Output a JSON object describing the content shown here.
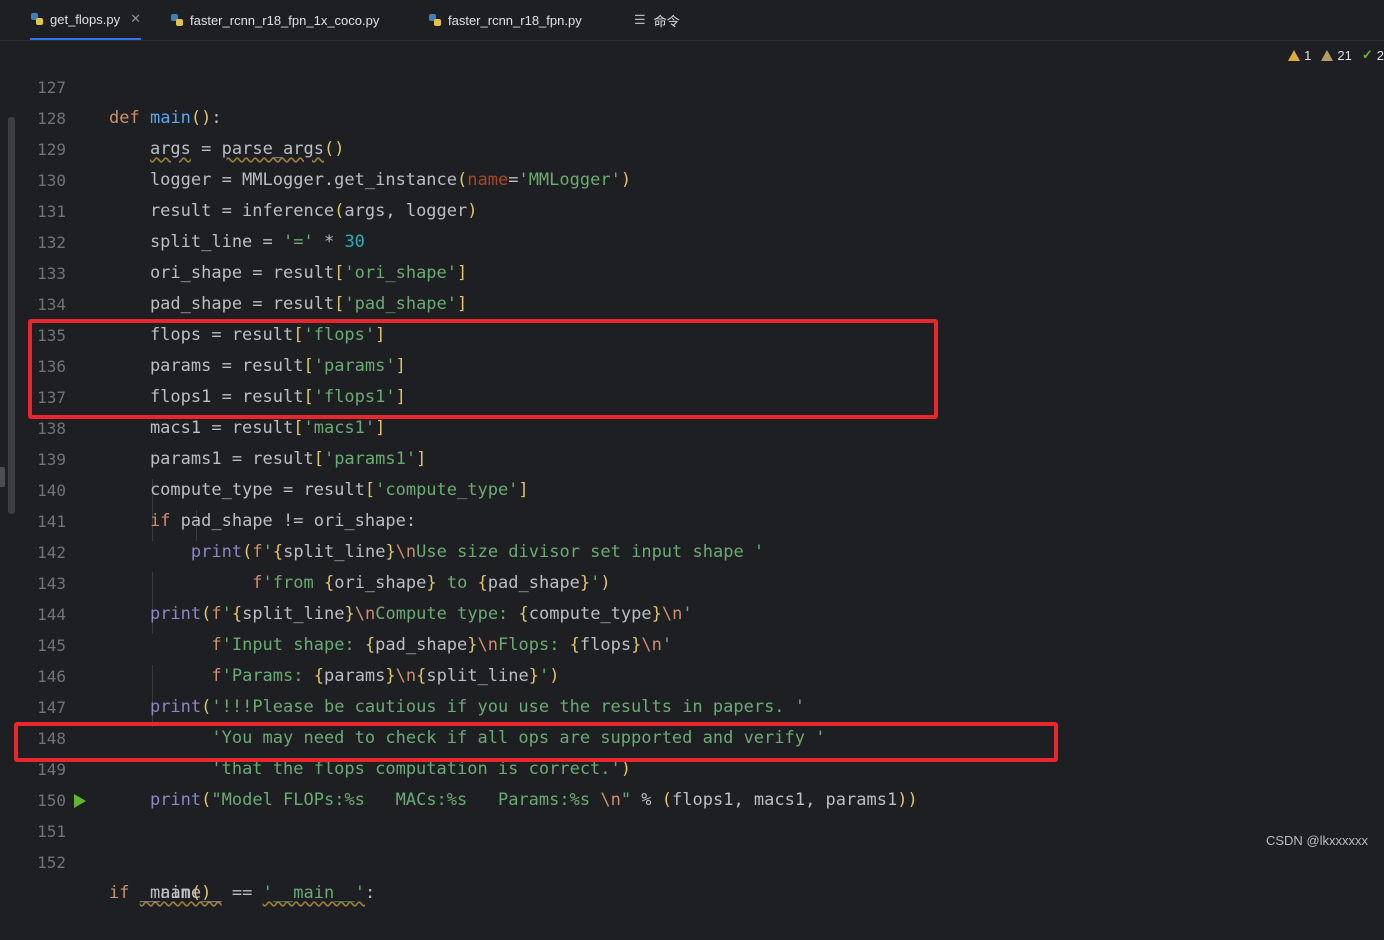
{
  "tabs": [
    {
      "label": "get_flops.py",
      "active": true,
      "closable": true,
      "icon": "python-icon"
    },
    {
      "label": "faster_rcnn_r18_fpn_1x_coco.py",
      "active": false,
      "closable": false,
      "icon": "python-icon"
    },
    {
      "label": "faster_rcnn_r18_fpn.py",
      "active": false,
      "closable": false,
      "icon": "python-icon"
    },
    {
      "label": "命令",
      "active": false,
      "closable": false,
      "icon": "command-list-icon"
    }
  ],
  "inspections": {
    "warnings": "1",
    "weak_warnings": "21",
    "typos": "2"
  },
  "lines": [
    {
      "n": "127",
      "text": "def main():"
    },
    {
      "n": "128",
      "text": "    args = parse_args()"
    },
    {
      "n": "129",
      "text": "    logger = MMLogger.get_instance(name='MMLogger')"
    },
    {
      "n": "130",
      "text": "    result = inference(args, logger)"
    },
    {
      "n": "131",
      "text": "    split_line = '=' * 30"
    },
    {
      "n": "132",
      "text": "    ori_shape = result['ori_shape']"
    },
    {
      "n": "133",
      "text": "    pad_shape = result['pad_shape']"
    },
    {
      "n": "134",
      "text": "    flops = result['flops']"
    },
    {
      "n": "135",
      "text": "    params = result['params']"
    },
    {
      "n": "136",
      "text": "    flops1 = result['flops1']"
    },
    {
      "n": "137",
      "text": "    macs1 = result['macs1']"
    },
    {
      "n": "138",
      "text": "    params1 = result['params1']"
    },
    {
      "n": "139",
      "text": "    compute_type = result['compute_type']"
    },
    {
      "n": "140",
      "text": "    if pad_shape != ori_shape:"
    },
    {
      "n": "141",
      "text": "        print(f'{split_line}\\nUse size divisor set input shape '"
    },
    {
      "n": "142",
      "text": "              f'from {ori_shape} to {pad_shape}')"
    },
    {
      "n": "143",
      "text": "    print(f'{split_line}\\nCompute type: {compute_type}\\n'"
    },
    {
      "n": "144",
      "text": "          f'Input shape: {pad_shape}\\nFlops: {flops}\\n'"
    },
    {
      "n": "145",
      "text": "          f'Params: {params}\\n{split_line}')"
    },
    {
      "n": "146",
      "text": "    print('!!!Please be cautious if you use the results in papers. '"
    },
    {
      "n": "147",
      "text": "          'You may need to check if all ops are supported and verify '"
    },
    {
      "n": "148",
      "text": "          'that the flops computation is correct.')"
    },
    {
      "n": "149",
      "text": "    print(\"Model FLOPs:%s   MACs:%s   Params:%s \\n\" % (flops1, macs1, params1))"
    },
    {
      "n": "150",
      "text": ""
    },
    {
      "n": "151",
      "text": "if __name__ == '__main__':"
    },
    {
      "n": "152",
      "text": "    main()"
    }
  ],
  "colors": {
    "highlight_box": "#e8262b",
    "background": "#1e1f22",
    "accent": "#3574f0"
  },
  "watermark": "CSDN @lkxxxxxx"
}
